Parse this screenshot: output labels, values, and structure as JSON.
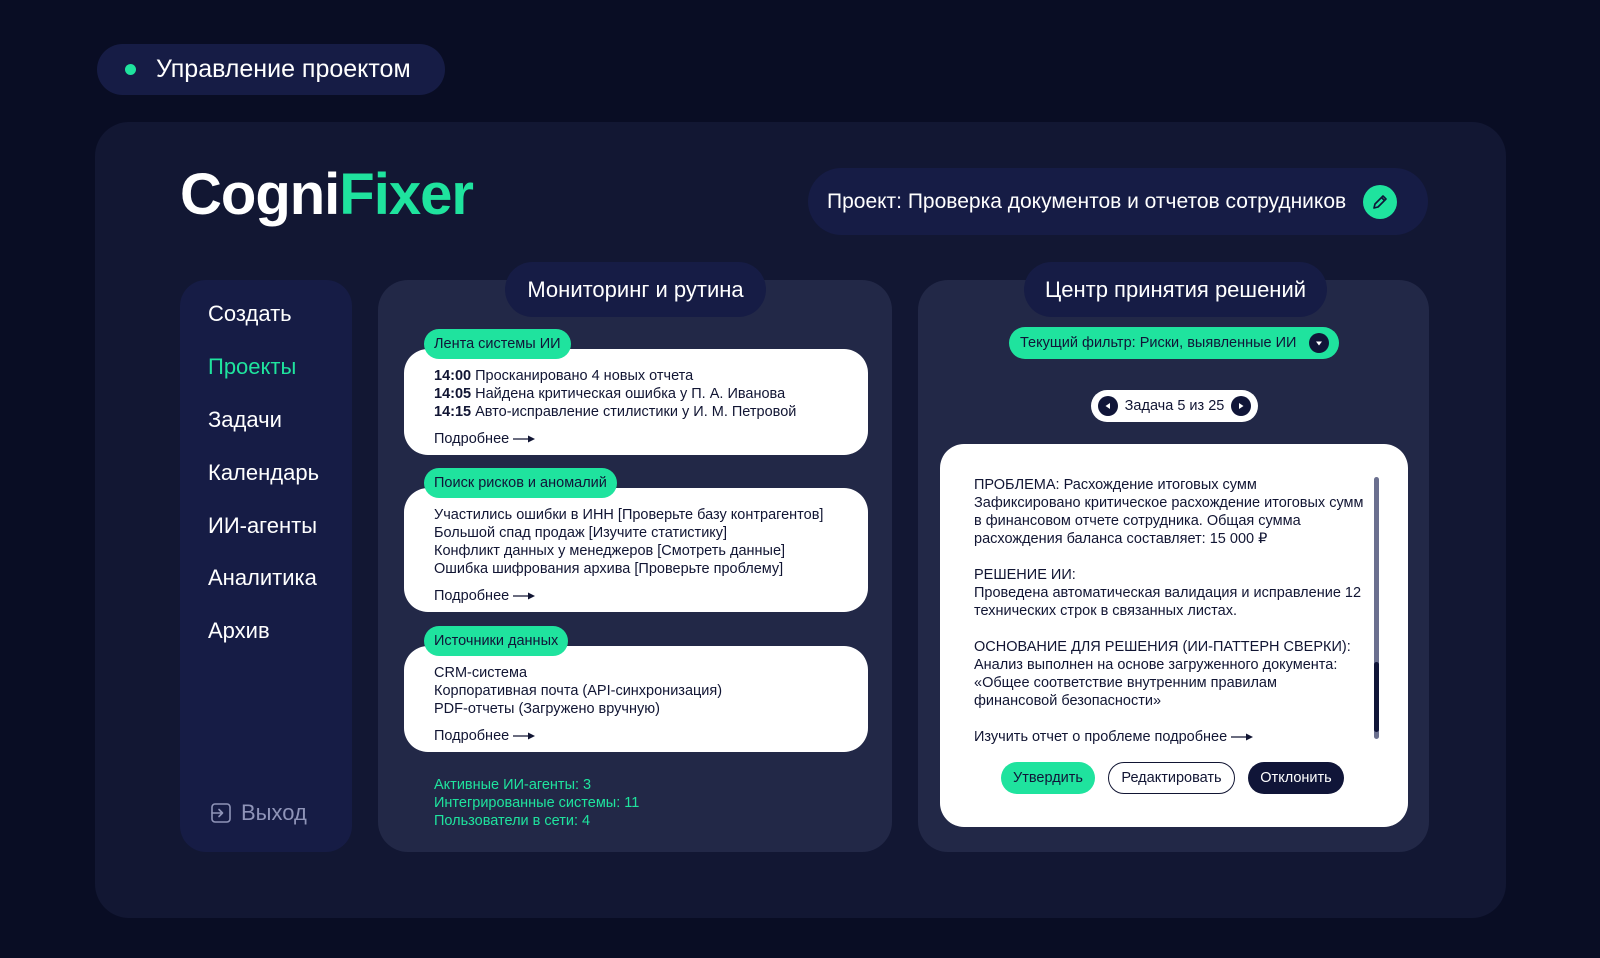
{
  "page": {
    "title": "Управление проектом"
  },
  "brand": {
    "part1": "Cogni",
    "part2": "Fixer"
  },
  "project": {
    "label": "Проект: Проверка документов и отчетов сотрудников",
    "edit_icon": "pencil-icon"
  },
  "sidebar": {
    "items": [
      {
        "label": "Создать",
        "active": false
      },
      {
        "label": "Проекты",
        "active": true
      },
      {
        "label": "Задачи",
        "active": false
      },
      {
        "label": "Календарь",
        "active": false
      },
      {
        "label": "ИИ-агенты",
        "active": false
      },
      {
        "label": "Аналитика",
        "active": false
      },
      {
        "label": "Архив",
        "active": false
      }
    ],
    "logout": "Выход"
  },
  "monitoring": {
    "title": "Мониторинг и рутина",
    "feed": {
      "tag": "Лента системы ИИ",
      "rows": [
        {
          "time": "14:00",
          "text": "Просканировано 4 новых отчета"
        },
        {
          "time": "14:05",
          "text": "Найдена критическая ошибка у П. А. Иванова"
        },
        {
          "time": "14:15",
          "text": "Авто-исправление стилистики у И. М. Петровой"
        }
      ],
      "more": "Подробнее"
    },
    "risks": {
      "tag": "Поиск рисков и аномалий",
      "rows": [
        "Участились ошибки в ИНН [Проверьте базу контрагентов]",
        "Большой спад продаж [Изучите статистику]",
        "Конфликт данных у менеджеров [Смотреть данные]",
        "Ошибка шифрования архива [Проверьте проблему]"
      ],
      "more": "Подробнее"
    },
    "sources": {
      "tag": "Источники данных",
      "rows": [
        "CRM-система",
        "Корпоративная почта (API-синхронизация)",
        "PDF-отчеты (Загружено вручную)"
      ],
      "more": "Подробнее"
    },
    "stats": [
      "Активные ИИ-агенты: 3",
      "Интегрированные системы: 11",
      "Пользователи в сети: 4"
    ]
  },
  "decisions": {
    "title": "Центр принятия решений",
    "filter": "Текущий фильтр: Риски, выявленные ИИ",
    "pager": "Задача 5 из 25",
    "problem": {
      "heading": "ПРОБЛЕМА: Расхождение итоговых сумм",
      "text": "Зафиксировано критическое расхождение итоговых сумм в финансовом отчете сотрудника. Общая сумма расхождения баланса составляет: 15 000 ₽"
    },
    "solution": {
      "heading": "РЕШЕНИЕ ИИ:",
      "text": "Проведена автоматическая валидация и исправление 12 технических строк в связанных листах."
    },
    "basis": {
      "heading": "ОСНОВАНИЕ ДЛЯ РЕШЕНИЯ (ИИ-ПАТТЕРН СВЕРКИ):",
      "text": "Анализ выполнен на основе загруженного документа: «Общее соответствие внутренним правилам финансовой безопасности»"
    },
    "link": "Изучить отчет о проблеме подробнее",
    "actions": {
      "approve": "Утвердить",
      "edit": "Редактировать",
      "reject": "Отклонить"
    }
  },
  "colors": {
    "background": "#090d24",
    "accent": "#1fe39e",
    "panel": "#222847",
    "pill": "#161c45"
  }
}
